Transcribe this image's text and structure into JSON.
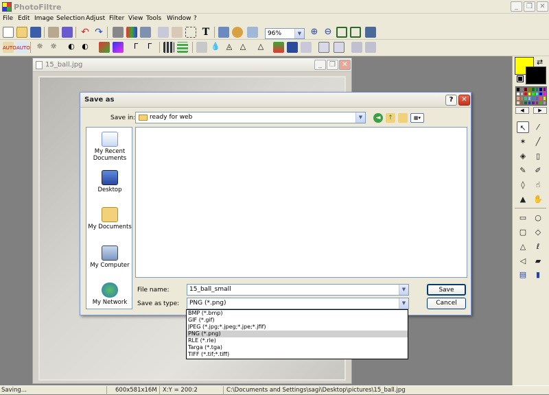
{
  "app": {
    "title": "PhotoFiltre"
  },
  "menu": [
    "File",
    "Edit",
    "Image",
    "Selection",
    "Adjust",
    "Filter",
    "View",
    "Tools",
    "Window",
    "?"
  ],
  "toolbar": {
    "zoom": "96%"
  },
  "image_window": {
    "title": "15_ball.jpg"
  },
  "dialog": {
    "title": "Save as",
    "help": "?",
    "close": "✕",
    "save_in_label": "Save in:",
    "save_in_value": "ready for web",
    "places": [
      "My Recent Documents",
      "Desktop",
      "My Documents",
      "My Computer",
      "My Network"
    ],
    "file_name_label": "File name:",
    "file_name_value": "15_ball_small",
    "save_type_label": "Save as type:",
    "save_type_value": "PNG (*.png)",
    "save_button": "Save",
    "cancel_button": "Cancel",
    "type_options": [
      "BMP (*.bmp)",
      "GIF (*.gif)",
      "JPEG (*.jpg;*.jpeg;*.jpe;*.jfif)",
      "PNG (*.png)",
      "RLE (*.rle)",
      "Targa (*.tga)",
      "TIFF (*.tif;*.tiff)"
    ],
    "selected_option_index": 3
  },
  "status": {
    "message": "Saving...",
    "dimensions": "600x581x16M",
    "coords": "X:Y = 200:2",
    "path": "C:\\Documents and Settings\\sagi\\Desktop\\pictures\\15_ball.jpg"
  },
  "colors": {
    "foreground": "#ffff00",
    "background": "#000000",
    "dialog_border": "#7a96df",
    "close_button": "#c4331c"
  },
  "icons": [
    "new-icon",
    "open-icon",
    "save-icon",
    "print-icon",
    "undo-icon",
    "redo-icon",
    "text-icon",
    "zoom-in-icon",
    "zoom-out-icon",
    "pointer-icon",
    "eyedropper-icon",
    "magic-wand-icon",
    "line-icon",
    "fill-icon",
    "spray-icon",
    "brush-icon",
    "smudge-icon",
    "blur-icon",
    "finger-icon",
    "stamp-icon",
    "hand-icon",
    "rectangle-icon",
    "ellipse-icon",
    "rounded-rect-icon",
    "diamond-icon",
    "triangle-icon",
    "lasso-icon",
    "polygon-icon",
    "folder-icon"
  ]
}
